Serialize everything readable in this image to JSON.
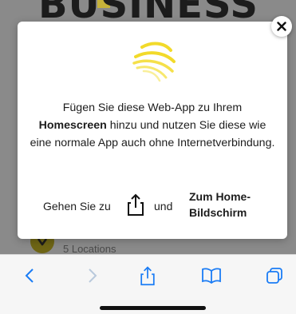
{
  "background_page": {
    "logo_text": "BUSINESS",
    "locations_label": "5 Locations"
  },
  "popup": {
    "message_part1": "Fügen Sie diese Web-App zu Ihrem",
    "message_bold": "Homescreen",
    "message_part2": "hinzu und nutzen Sie diese wie eine normale App auch ohne Internetverbindung.",
    "instruction_goto": "Gehen Sie zu",
    "instruction_and": "und",
    "instruction_target": "Zum Home-Bildschirm",
    "close_icon": "close-icon"
  },
  "toolbar": {
    "back_icon": "chevron-left-icon",
    "forward_icon": "chevron-right-icon",
    "share_icon": "share-icon",
    "bookmarks_icon": "book-icon",
    "tabs_icon": "tabs-icon"
  },
  "colors": {
    "accent": "#1a7cf5",
    "logo_yellow": "#f2da2a",
    "dim_overlay": "#7d7d7d"
  }
}
